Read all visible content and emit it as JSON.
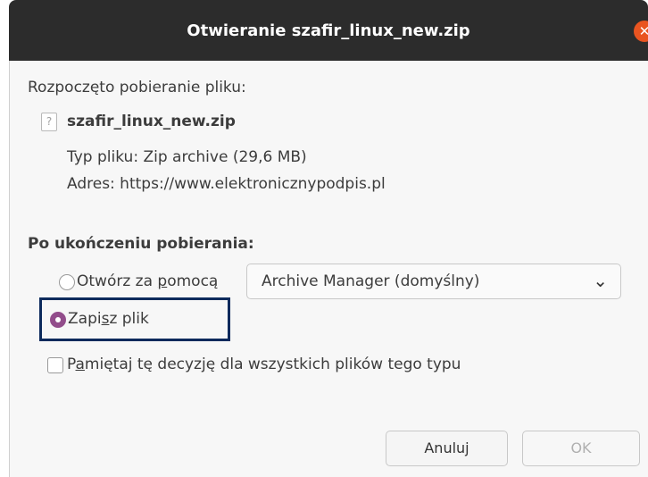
{
  "window": {
    "title": "Otwieranie szafir_linux_new.zip",
    "close_glyph": "✕"
  },
  "dialog": {
    "download_started": "Rozpoczęto pobieranie pliku:",
    "file_name": "szafir_linux_new.zip",
    "file_icon_glyph": "?",
    "file_type": "Typ pliku: Zip archive (29,6 MB)",
    "source": "Adres: https://www.elektronicznypodpis.pl",
    "after_download_heading": "Po ukończeniu pobierania:",
    "open_with_label_a": "Otwórz za ",
    "open_with_label_b": "p",
    "open_with_label_c": "omocą",
    "open_with_app": "Archive Manager (domyślny)",
    "save_label_a": "Zapi",
    "save_label_b": "s",
    "save_label_c": "z plik",
    "remember_label_a": "P",
    "remember_label_b": "a",
    "remember_label_c": "miętaj tę decyzję dla wszystkich plików tego typu",
    "cancel_label": "Anuluj",
    "ok_label": "OK"
  },
  "state": {
    "selected_action": "save",
    "remember_checked": false,
    "ok_enabled": false
  },
  "icons": {
    "close": "close-icon",
    "file": "unknown-file-icon",
    "dropdown": "chevron-down-icon"
  },
  "colors": {
    "titlebar": "#2c2c2c",
    "close_button": "#e95420",
    "radio_accent": "#924d8b",
    "highlight_border": "#0d2a5c"
  }
}
